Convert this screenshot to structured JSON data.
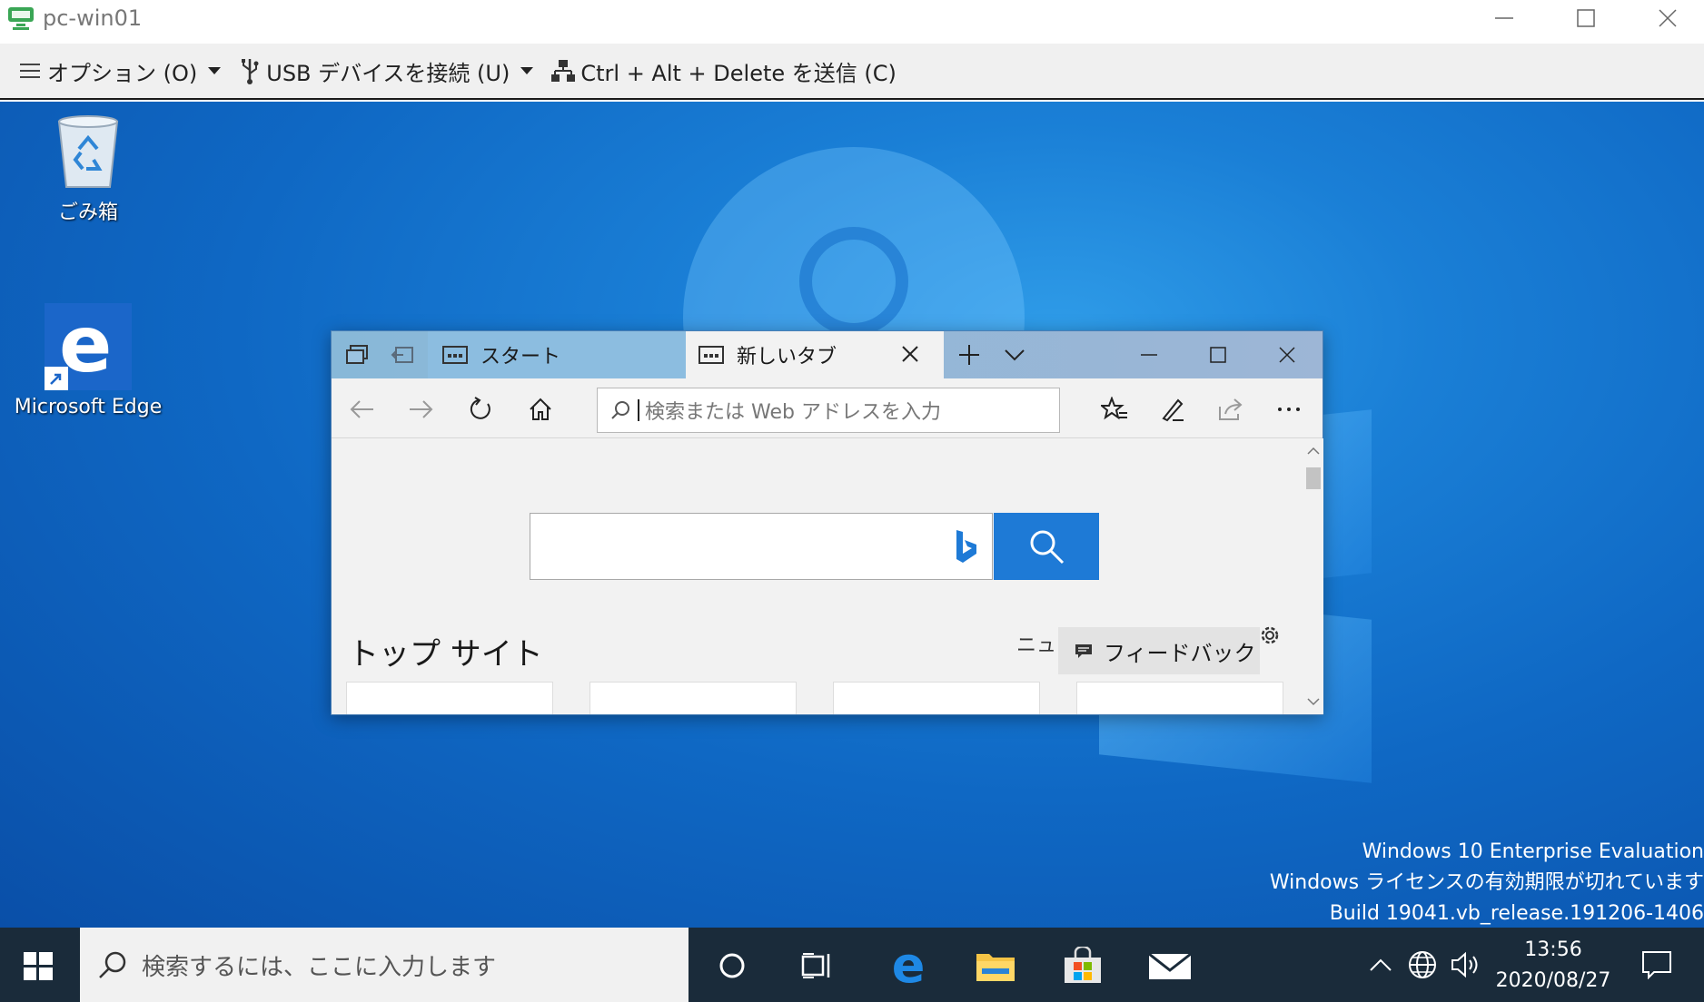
{
  "vm_window": {
    "title": "pc-win01"
  },
  "vm_toolbar": {
    "options_label": "オプション (O)",
    "usb_label": "USB デバイスを接続 (U)",
    "cad_label": "Ctrl + Alt + Delete を送信 (C)"
  },
  "desktop": {
    "icons": [
      {
        "label": "ごみ箱",
        "icon": "recycle-bin-icon"
      },
      {
        "label": "Microsoft Edge",
        "icon": "edge-icon"
      }
    ],
    "watermark": {
      "line1": "Windows 10 Enterprise Evaluation",
      "line2": "Windows ライセンスの有効期限が切れています",
      "line3": "Build 19041.vb_release.191206-1406"
    }
  },
  "edge": {
    "tabs": [
      {
        "label": "スタート",
        "active": false
      },
      {
        "label": "新しいタブ",
        "active": true
      }
    ],
    "address_placeholder": "検索または Web アドレスを入力",
    "top_sites_heading": "トップ サイト",
    "news_partial": "ニュ",
    "feedback_label": "フィードバック",
    "accent_color": "#1e7ad6"
  },
  "taskbar": {
    "search_placeholder": "検索するには、ここに入力します",
    "time": "13:56",
    "date": "2020/08/27"
  }
}
